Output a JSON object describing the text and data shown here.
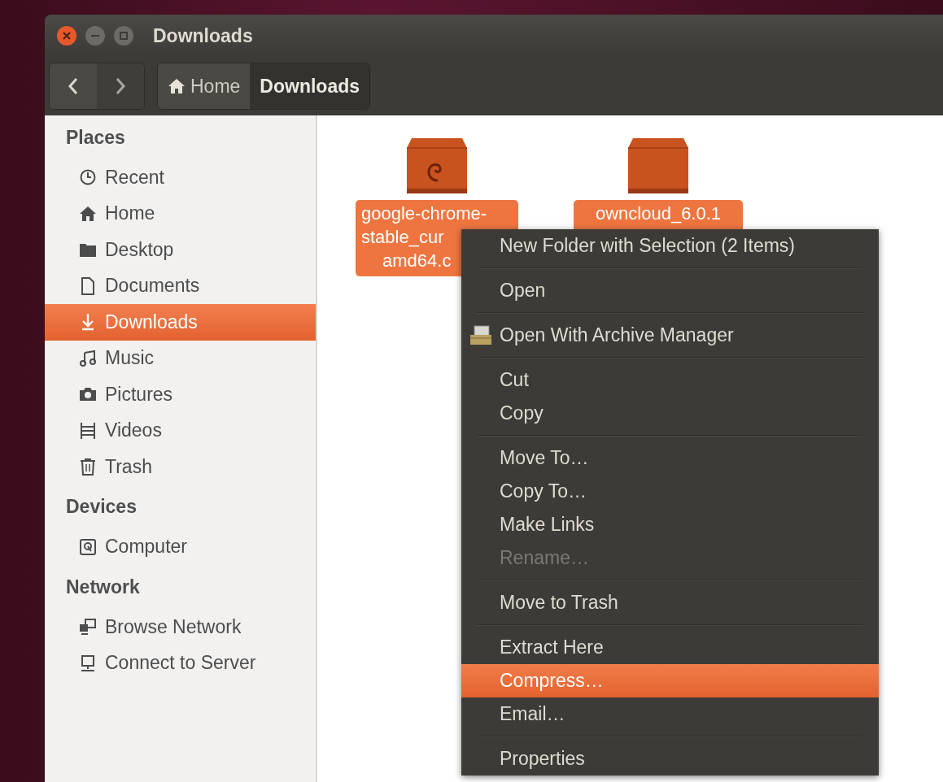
{
  "window": {
    "title": "Downloads"
  },
  "toolbar": {
    "breadcrumbs": [
      {
        "label": "Home",
        "selected": false
      },
      {
        "label": "Downloads",
        "selected": true
      }
    ]
  },
  "sidebar": {
    "sections": [
      {
        "heading": "Places",
        "items": [
          {
            "label": "Recent",
            "selected": false
          },
          {
            "label": "Home",
            "selected": false
          },
          {
            "label": "Desktop",
            "selected": false
          },
          {
            "label": "Documents",
            "selected": false
          },
          {
            "label": "Downloads",
            "selected": true
          },
          {
            "label": "Music",
            "selected": false
          },
          {
            "label": "Pictures",
            "selected": false
          },
          {
            "label": "Videos",
            "selected": false
          },
          {
            "label": "Trash",
            "selected": false
          }
        ]
      },
      {
        "heading": "Devices",
        "items": [
          {
            "label": "Computer",
            "selected": false
          }
        ]
      },
      {
        "heading": "Network",
        "items": [
          {
            "label": "Browse Network",
            "selected": false
          },
          {
            "label": "Connect to Server",
            "selected": false
          }
        ]
      }
    ]
  },
  "files": [
    {
      "name_lines": [
        "google-chrome-",
        "stable_cur",
        "amd64.c"
      ],
      "selected": true
    },
    {
      "name_lines": [
        "owncloud_6.0.1"
      ],
      "selected": true
    }
  ],
  "context_menu": {
    "groups": [
      [
        {
          "kind": "item",
          "label": "New Folder with Selection (2 Items)",
          "disabled": false,
          "selected": false
        }
      ],
      [
        {
          "kind": "item",
          "label": "Open",
          "disabled": false,
          "selected": false
        }
      ],
      [
        {
          "kind": "icon-item",
          "label": "Open With Archive Manager",
          "disabled": false,
          "selected": false
        }
      ],
      [
        {
          "kind": "item",
          "label": "Cut",
          "disabled": false,
          "selected": false
        },
        {
          "kind": "item",
          "label": "Copy",
          "disabled": false,
          "selected": false
        }
      ],
      [
        {
          "kind": "item",
          "label": "Move To…",
          "disabled": false,
          "selected": false
        },
        {
          "kind": "item",
          "label": "Copy To…",
          "disabled": false,
          "selected": false
        },
        {
          "kind": "item",
          "label": "Make Links",
          "disabled": false,
          "selected": false
        },
        {
          "kind": "item",
          "label": "Rename…",
          "disabled": true,
          "selected": false
        }
      ],
      [
        {
          "kind": "item",
          "label": "Move to Trash",
          "disabled": false,
          "selected": false
        }
      ],
      [
        {
          "kind": "item",
          "label": "Extract Here",
          "disabled": false,
          "selected": false
        },
        {
          "kind": "item",
          "label": "Compress…",
          "disabled": false,
          "selected": true
        },
        {
          "kind": "item",
          "label": "Email…",
          "disabled": false,
          "selected": false
        }
      ],
      [
        {
          "kind": "item",
          "label": "Properties",
          "disabled": false,
          "selected": false
        }
      ]
    ]
  }
}
